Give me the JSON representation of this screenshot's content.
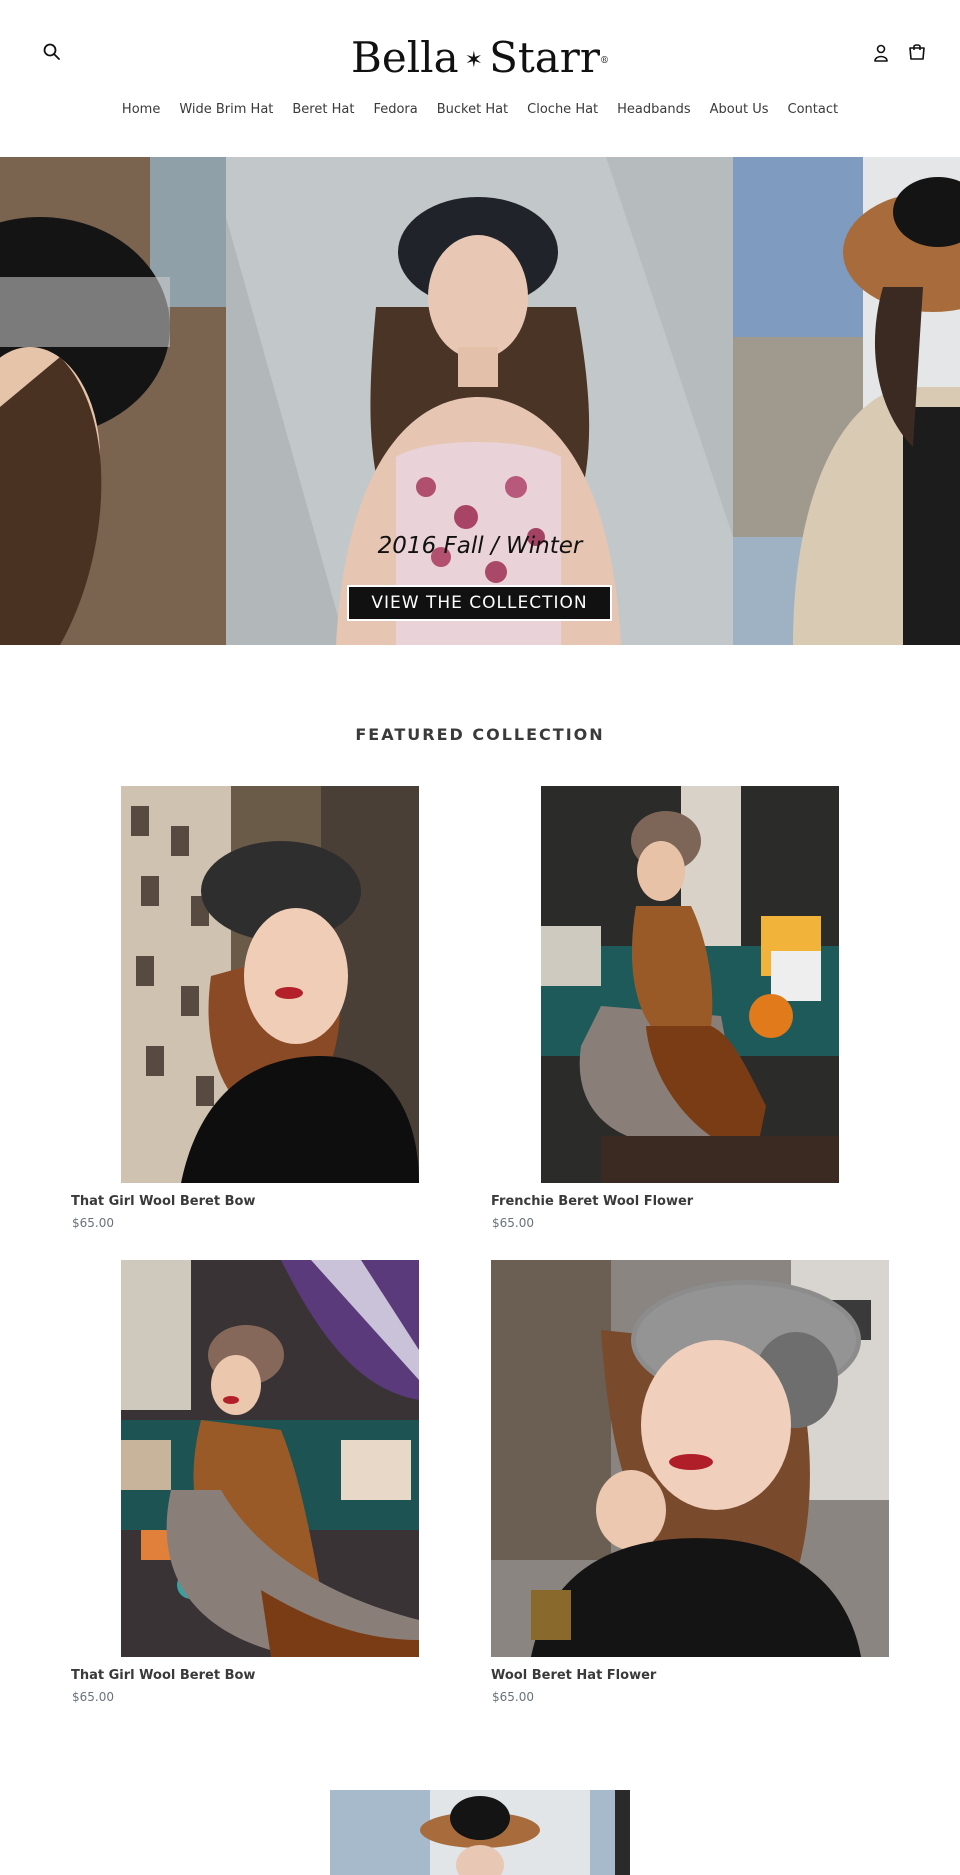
{
  "header": {
    "logo": {
      "name_left": "Bella",
      "star": "✶",
      "name_right": "Starr",
      "registered": "®"
    }
  },
  "nav": {
    "items": [
      {
        "label": "Home"
      },
      {
        "label": "Wide Brim Hat"
      },
      {
        "label": "Beret Hat"
      },
      {
        "label": "Fedora"
      },
      {
        "label": "Bucket Hat"
      },
      {
        "label": "Cloche Hat"
      },
      {
        "label": "Headbands"
      },
      {
        "label": "About Us"
      },
      {
        "label": "Contact"
      }
    ]
  },
  "hero": {
    "caption": "2016 Fall / Winter",
    "cta_label": "VIEW THE COLLECTION"
  },
  "featured": {
    "title": "FEATURED COLLECTION",
    "products": [
      {
        "name": "That Girl Wool Beret Bow",
        "price": "$65.00"
      },
      {
        "name": "Frenchie Beret Wool Flower",
        "price": "$65.00"
      },
      {
        "name": "That Girl Wool Beret Bow",
        "price": "$65.00"
      },
      {
        "name": "Wool Beret Hat Flower",
        "price": "$65.00"
      }
    ]
  },
  "icons": {
    "search": "search-icon",
    "account": "account-icon",
    "cart": "cart-icon"
  },
  "colors": {
    "text": "#3a3a3a",
    "price": "#69727b",
    "cta_bg": "#111111",
    "cta_text": "#ffffff"
  }
}
